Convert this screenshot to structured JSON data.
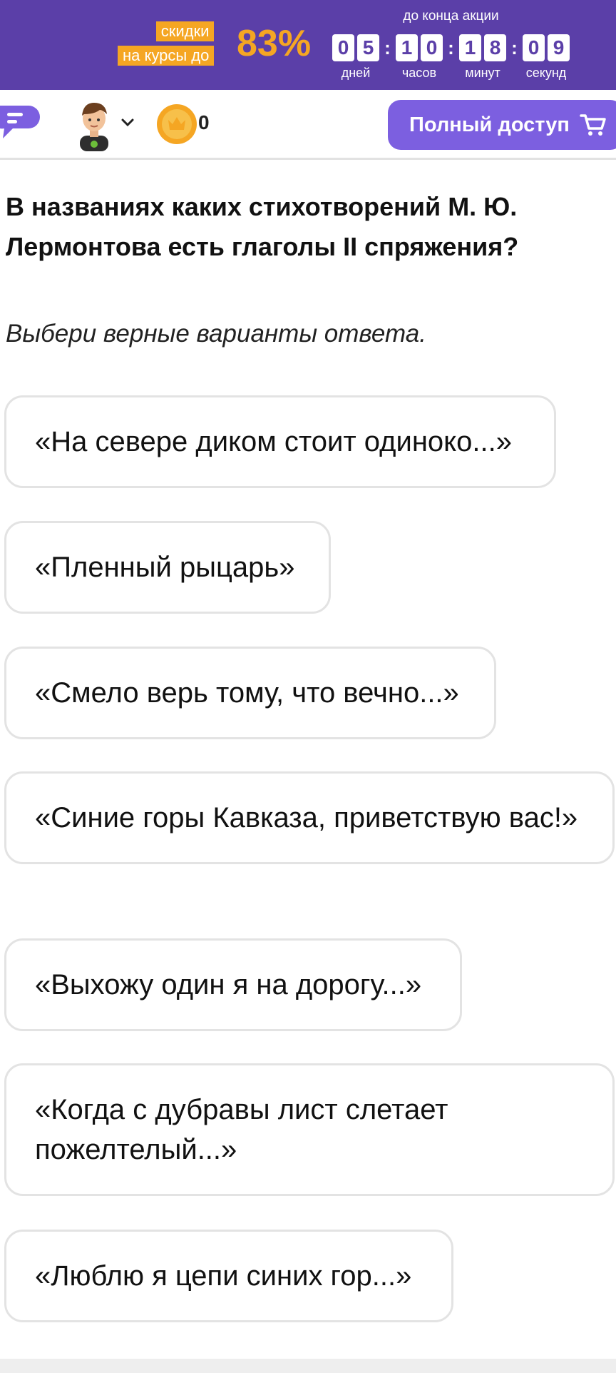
{
  "promo": {
    "label_line1": "скидки",
    "label_line2": "на курсы до",
    "percent": "83%",
    "caption": "до конца акции",
    "timer": [
      {
        "digits": [
          "0",
          "5"
        ],
        "label": "дней"
      },
      {
        "digits": [
          "1",
          "0"
        ],
        "label": "часов"
      },
      {
        "digits": [
          "1",
          "8"
        ],
        "label": "минут"
      },
      {
        "digits": [
          "0",
          "9"
        ],
        "label": "секунд"
      }
    ],
    "accent_color": "#f5a623",
    "background_color": "#5b3fa8"
  },
  "header": {
    "menu_icon": "chat-menu-icon",
    "avatar_icon": "boy-avatar-icon",
    "coins": "0",
    "full_access_label": "Полный доступ",
    "full_access_color": "#7c5fe0"
  },
  "question": {
    "text": "В названиях каких стихотворений М. Ю. Лермонтова есть глаголы II спряжения?",
    "hint": "Выбери верные варианты ответа."
  },
  "options": [
    "«На севере диком стоит одиноко...»",
    "«Пленный рыцарь»",
    "«Смело верь тому, что вечно...»",
    "«Синие горы Кавказа, приветствую вас!»",
    "«Выхожу один я на дорогу...»",
    "«Когда с дубравы лист слетает пожелтелый...»",
    "«Люблю я цепи синих гор...»"
  ]
}
